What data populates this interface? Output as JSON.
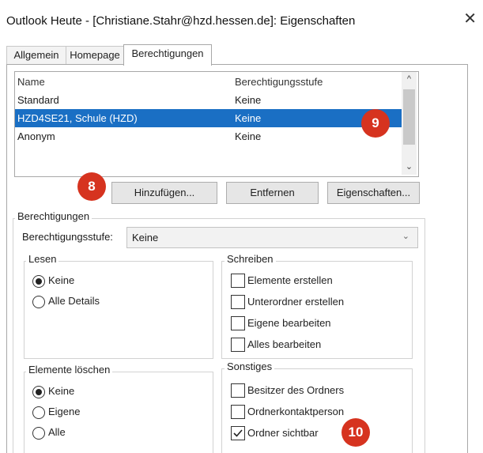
{
  "window": {
    "title": "Outlook Heute - [Christiane.Stahr@hzd.hessen.de]: Eigenschaften",
    "close_glyph": "✕"
  },
  "tabs": [
    "Allgemein",
    "Homepage",
    "Berechtigungen"
  ],
  "permission_list": {
    "columns": [
      "Name",
      "Berechtigungsstufe"
    ],
    "rows": [
      {
        "name": "Standard",
        "level": "Keine"
      },
      {
        "name": "HZD4SE21, Schule (HZD)",
        "level": "Keine"
      },
      {
        "name": "Anonym",
        "level": "Keine"
      }
    ],
    "scroll_up": "^",
    "scroll_down": "⌄"
  },
  "buttons": {
    "add": "Hinzufügen...",
    "remove": "Entfernen",
    "properties": "Eigenschaften..."
  },
  "badges": {
    "b8": "8",
    "b9": "9",
    "b10": "10"
  },
  "badge_color": "#d6331f",
  "selection_color": "#1a6fc4",
  "permissions": {
    "legend": "Berechtigungen",
    "level_label": "Berechtigungsstufe:",
    "level_value": "Keine",
    "read": {
      "legend": "Lesen",
      "options": [
        "Keine",
        "Alle Details"
      ]
    },
    "write": {
      "legend": "Schreiben",
      "options": [
        "Elemente erstellen",
        "Unterordner erstellen",
        "Eigene bearbeiten",
        "Alles bearbeiten"
      ]
    },
    "delete": {
      "legend": "Elemente löschen",
      "options": [
        "Keine",
        "Eigene",
        "Alle"
      ]
    },
    "other": {
      "legend": "Sonstiges",
      "options": [
        "Besitzer des Ordners",
        "Ordnerkontaktperson",
        "Ordner sichtbar"
      ]
    }
  }
}
